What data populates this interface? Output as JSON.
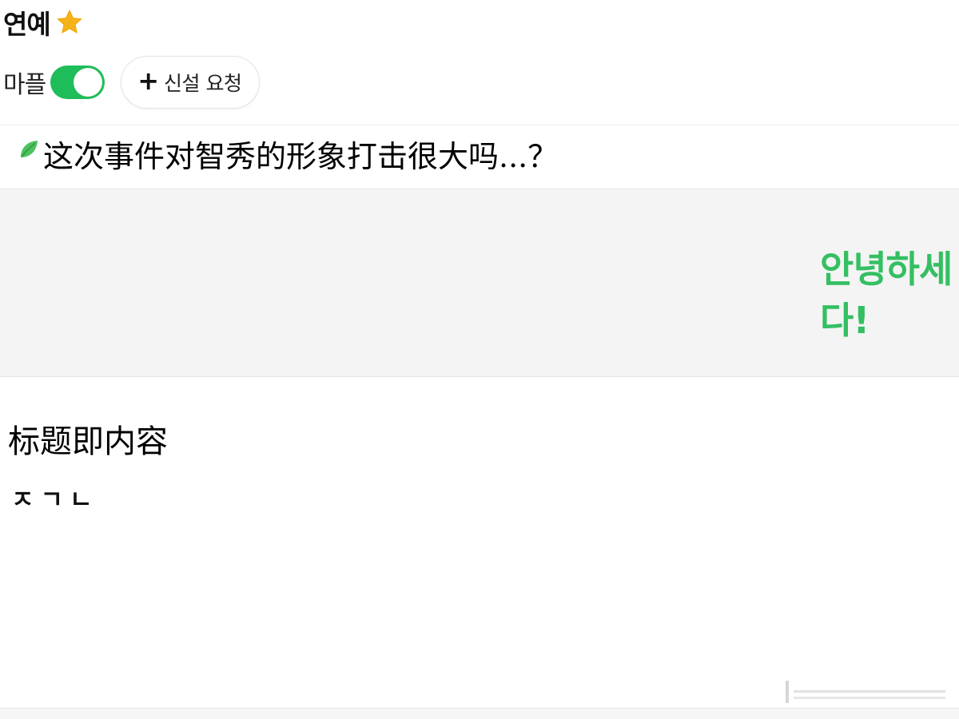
{
  "header": {
    "title": "연예",
    "favorite_icon": "star-icon",
    "favorite_color": "#f5b31b"
  },
  "controls": {
    "toggle_label": "마플",
    "toggle_on": true,
    "toggle_color": "#1fbd5a",
    "request_icon": "plus-icon",
    "request_label": "신설 요청"
  },
  "post": {
    "icon": "leaf-icon",
    "title": "这次事件对智秀的形象打击很大吗...？"
  },
  "banner": {
    "greeting_line1": "안녕하세",
    "greeting_line2": "다!",
    "greeting_color": "#34bf62"
  },
  "body": {
    "text": "标题即内容",
    "sub": "ㅈㄱㄴ"
  }
}
